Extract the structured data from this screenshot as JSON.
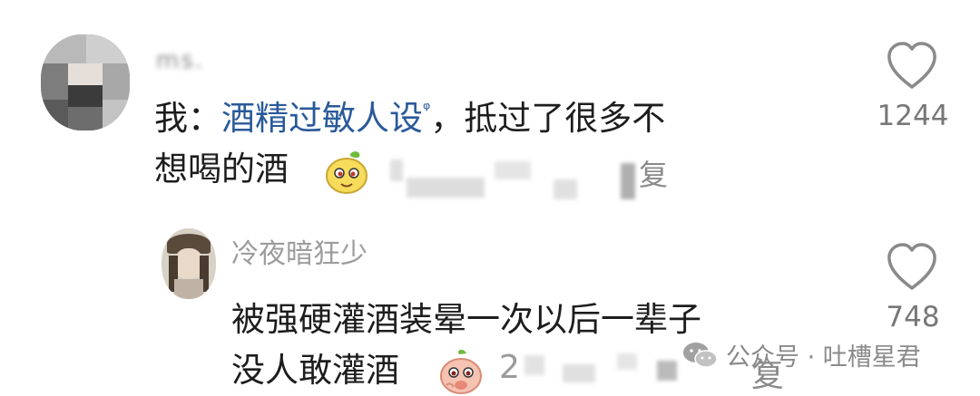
{
  "comments": [
    {
      "username": "ms.",
      "text_prefix": "我：",
      "topic": "酒精过敏人设",
      "search_mark": "ᵠ",
      "text_after": "，抵过了很多不",
      "text_line2": "想喝的酒",
      "meta_tail": "复",
      "like_count": "1244"
    },
    {
      "username": "冷夜暗狂少",
      "text_line1": "被强硬灌酒装晕一次以后一辈子",
      "text_line2": "没人敢灌酒",
      "meta_start": "2",
      "meta_tail": "复",
      "like_count": "748"
    }
  ],
  "watermark": {
    "text": "公众号 · 吐槽星君",
    "icon": "wechat-icon"
  },
  "colors": {
    "topic_link": "#2a5a9a",
    "username": "#9c9c9c",
    "text": "#1d1d1d",
    "like_count": "#777777"
  }
}
